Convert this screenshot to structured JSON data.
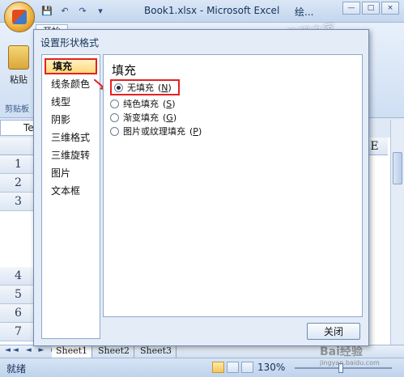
{
  "window": {
    "title": "Book1.xlsx - Microsoft Excel",
    "title_extra": "绘...",
    "buttons": [
      "—",
      "□",
      "×"
    ]
  },
  "ribbon": {
    "home_tab": "开始",
    "paste_label": "粘贴",
    "clipboard_group": "剪贴板"
  },
  "namebox": {
    "value": "Te"
  },
  "grid": {
    "column_e": "E",
    "rows": [
      "1",
      "2",
      "3",
      "4",
      "5",
      "6",
      "7"
    ]
  },
  "sheets": {
    "nav": "◄◄ ◄ ► ►►",
    "tabs": [
      "Sheet1",
      "Sheet2",
      "Sheet3"
    ],
    "active_index": 0
  },
  "statusbar": {
    "status": "就绪",
    "zoom": "130%",
    "zoom_minus": "⊖",
    "zoom_plus": "⊕"
  },
  "dialog": {
    "title": "设置形状格式",
    "nav_items": [
      "填充",
      "线条颜色",
      "线型",
      "阴影",
      "三维格式",
      "三维旋转",
      "图片",
      "文本框"
    ],
    "active_nav_index": 0,
    "panel_heading": "填充",
    "fill_options": [
      {
        "label": "无填充",
        "key": "N",
        "checked": true
      },
      {
        "label": "纯色填充",
        "key": "S",
        "checked": false
      },
      {
        "label": "渐变填充",
        "key": "G",
        "checked": false
      },
      {
        "label": "图片或纹理填充",
        "key": "P",
        "checked": false
      }
    ],
    "close_label": "关闭"
  },
  "watermark": {
    "top": "教程之家",
    "bottom": "Bai经验",
    "bottom_sub": "jingyan.baidu.com"
  },
  "colors": {
    "highlight": "#e62020",
    "dialog_bg": "#e3ecf7",
    "ribbon_blue": "#cfdff3"
  }
}
